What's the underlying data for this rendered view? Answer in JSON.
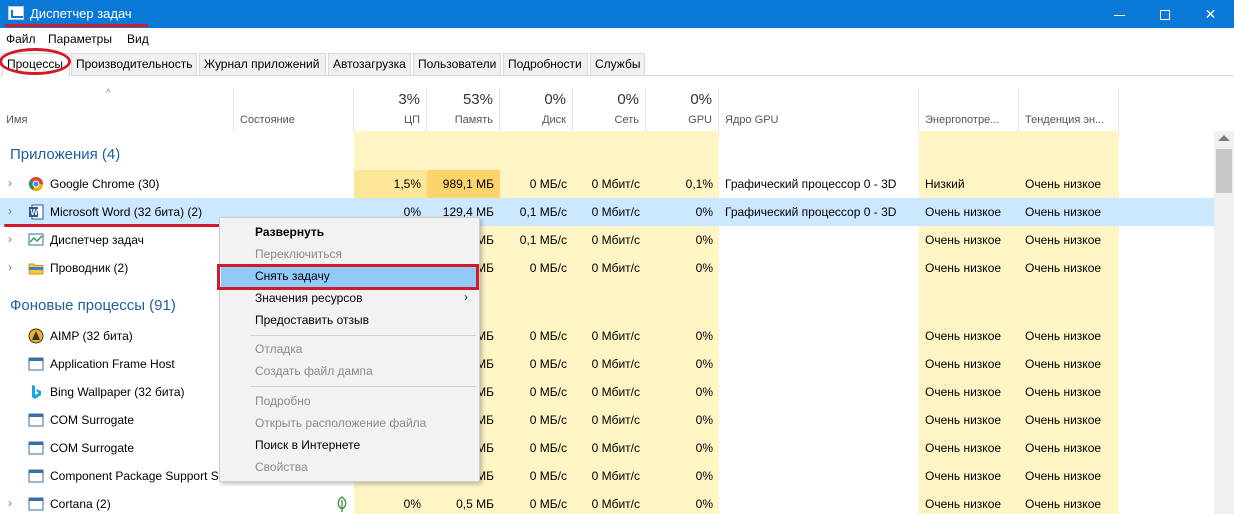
{
  "window": {
    "title": "Диспетчер задач"
  },
  "menu": [
    "Файл",
    "Параметры",
    "Вид"
  ],
  "tabs": [
    "Процессы",
    "Производительность",
    "Журнал приложений",
    "Автозагрузка",
    "Пользователи",
    "Подробности",
    "Службы"
  ],
  "header": {
    "name": "Имя",
    "status": "Состояние",
    "cpu": {
      "pct": "3%",
      "label": "ЦП"
    },
    "mem": {
      "pct": "53%",
      "label": "Память"
    },
    "disk": {
      "pct": "0%",
      "label": "Диск"
    },
    "net": {
      "pct": "0%",
      "label": "Сеть"
    },
    "gpu": {
      "pct": "0%",
      "label": "GPU"
    },
    "gpu_engine": "Ядро GPU",
    "power": "Энергопотре...",
    "power_trend": "Тенденция эн..."
  },
  "groups": {
    "apps": "Приложения (4)",
    "background": "Фоновые процессы (91)"
  },
  "rows": [
    {
      "name": "Google Chrome (30)",
      "cpu": "1,5%",
      "mem": "989,1 МБ",
      "disk": "0 МБ/с",
      "net": "0 Мбит/с",
      "gpu": "0,1%",
      "engine": "Графический процессор 0 - 3D",
      "power": "Низкий",
      "trend": "Очень низкое"
    },
    {
      "name": "Microsoft Word (32 бита) (2)",
      "cpu": "0%",
      "mem": "129,4 МБ",
      "disk": "0,1 МБ/с",
      "net": "0 Мбит/с",
      "gpu": "0%",
      "engine": "Графический процессор 0 - 3D",
      "power": "Очень низкое",
      "trend": "Очень низкое"
    },
    {
      "name": "Диспетчер задач",
      "cpu": "",
      "mem": "МБ",
      "disk": "0,1 МБ/с",
      "net": "0 Мбит/с",
      "gpu": "0%",
      "engine": "",
      "power": "Очень низкое",
      "trend": "Очень низкое"
    },
    {
      "name": "Проводник (2)",
      "cpu": "",
      "mem": "МБ",
      "disk": "0 МБ/с",
      "net": "0 Мбит/с",
      "gpu": "0%",
      "engine": "",
      "power": "Очень низкое",
      "trend": "Очень низкое"
    },
    {
      "name": "AIMP (32 бита)",
      "cpu": "",
      "mem": "МБ",
      "disk": "0 МБ/с",
      "net": "0 Мбит/с",
      "gpu": "0%",
      "engine": "",
      "power": "Очень низкое",
      "trend": "Очень низкое"
    },
    {
      "name": "Application Frame Host",
      "cpu": "",
      "mem": "МБ",
      "disk": "0 МБ/с",
      "net": "0 Мбит/с",
      "gpu": "0%",
      "engine": "",
      "power": "Очень низкое",
      "trend": "Очень низкое"
    },
    {
      "name": "Bing Wallpaper (32 бита)",
      "cpu": "",
      "mem": "МБ",
      "disk": "0 МБ/с",
      "net": "0 Мбит/с",
      "gpu": "0%",
      "engine": "",
      "power": "Очень низкое",
      "trend": "Очень низкое"
    },
    {
      "name": "COM Surrogate",
      "cpu": "",
      "mem": "МБ",
      "disk": "0 МБ/с",
      "net": "0 Мбит/с",
      "gpu": "0%",
      "engine": "",
      "power": "Очень низкое",
      "trend": "Очень низкое"
    },
    {
      "name": "COM Surrogate",
      "cpu": "",
      "mem": "МБ",
      "disk": "0 МБ/с",
      "net": "0 Мбит/с",
      "gpu": "0%",
      "engine": "",
      "power": "Очень низкое",
      "trend": "Очень низкое"
    },
    {
      "name": "Component Package Support S...",
      "cpu": "",
      "mem": "МБ",
      "disk": "0 МБ/с",
      "net": "0 Мбит/с",
      "gpu": "0%",
      "engine": "",
      "power": "Очень низкое",
      "trend": "Очень низкое"
    },
    {
      "name": "Cortana (2)",
      "cpu": "0%",
      "mem": "0,5 МБ",
      "disk": "0 МБ/с",
      "net": "0 Мбит/с",
      "gpu": "0%",
      "engine": "",
      "power": "Очень низкое",
      "trend": "Очень низкое"
    }
  ],
  "context_menu": [
    {
      "label": "Развернуть",
      "state": "bold"
    },
    {
      "label": "Переключиться",
      "state": "disabled"
    },
    {
      "label": "Снять задачу",
      "state": "highlight"
    },
    {
      "label": "Значения ресурсов",
      "state": "submenu"
    },
    {
      "label": "Предоставить отзыв",
      "state": "normal"
    },
    {
      "label": "Отладка",
      "state": "disabled"
    },
    {
      "label": "Создать файл дампа",
      "state": "disabled"
    },
    {
      "label": "Подробно",
      "state": "disabled"
    },
    {
      "label": "Открыть расположение файла",
      "state": "disabled"
    },
    {
      "label": "Поиск в Интернете",
      "state": "normal"
    },
    {
      "label": "Свойства",
      "state": "disabled"
    }
  ],
  "colors": {
    "titlebar": "#0a78d7",
    "annotation": "#d11a2a",
    "highlight": "#91c9f7",
    "selected": "#cce8ff",
    "heat": "#fff4c4",
    "heat_strong": "#ffe79a"
  }
}
